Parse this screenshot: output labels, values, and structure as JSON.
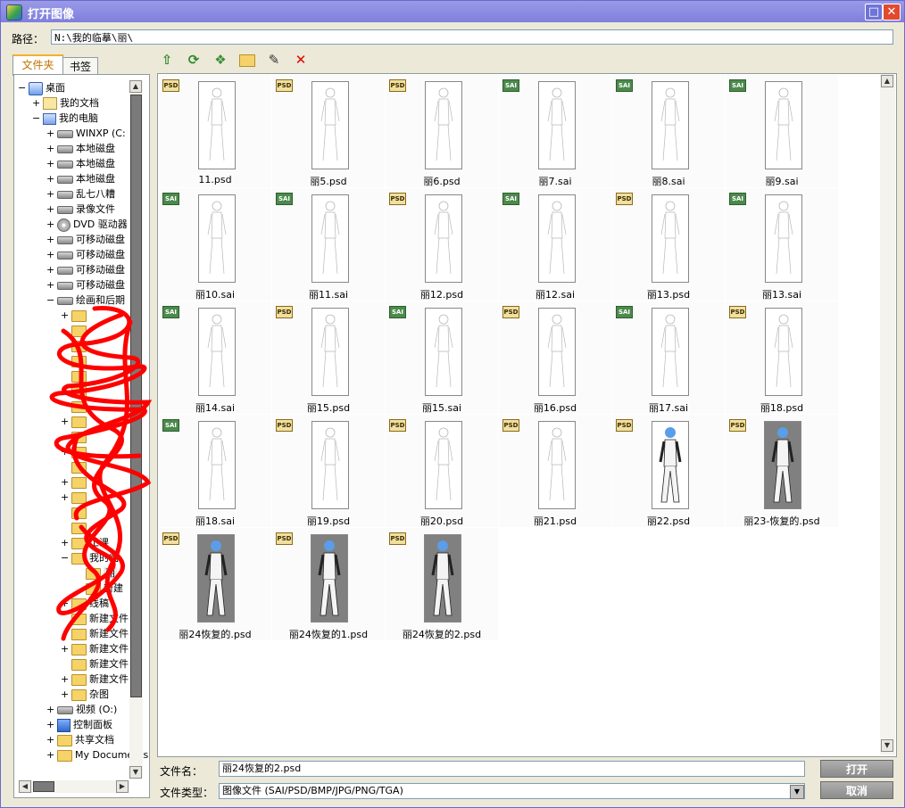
{
  "window": {
    "title": "打开图像"
  },
  "path": {
    "label": "路径：",
    "value": "N:\\我的临摹\\丽\\"
  },
  "tabs": {
    "folders": "文件夹",
    "bookmarks": "书签"
  },
  "tree": [
    {
      "label": "桌面",
      "exp": "−",
      "icon": "desktop-icon"
    },
    {
      "label": "我的文档",
      "exp": "+",
      "icon": "documents-icon"
    },
    {
      "label": "我的电脑",
      "exp": "−",
      "icon": "computer-icon"
    },
    {
      "label": "WINXP (C:",
      "exp": "+",
      "icon": "drive-icon"
    },
    {
      "label": "本地磁盘",
      "exp": "+",
      "icon": "drive-icon"
    },
    {
      "label": "本地磁盘",
      "exp": "+",
      "icon": "drive-icon"
    },
    {
      "label": "本地磁盘",
      "exp": "+",
      "icon": "drive-icon"
    },
    {
      "label": "乱七八糟",
      "exp": "+",
      "icon": "drive-icon"
    },
    {
      "label": "录像文件",
      "exp": "+",
      "icon": "drive-icon"
    },
    {
      "label": "DVD 驱动器",
      "exp": "+",
      "icon": "dvd-icon"
    },
    {
      "label": "可移动磁盘",
      "exp": "+",
      "icon": "drive-icon"
    },
    {
      "label": "可移动磁盘",
      "exp": "+",
      "icon": "drive-icon"
    },
    {
      "label": "可移动磁盘",
      "exp": "+",
      "icon": "drive-icon"
    },
    {
      "label": "可移动磁盘",
      "exp": "+",
      "icon": "drive-icon"
    },
    {
      "label": "绘画和后期",
      "exp": "−",
      "icon": "drive-icon"
    },
    {
      "label": "",
      "exp": "+",
      "icon": "folder-icon"
    },
    {
      "label": "",
      "exp": "",
      "icon": "folder-icon"
    },
    {
      "label": "",
      "exp": "",
      "icon": "folder-icon"
    },
    {
      "label": "",
      "exp": "",
      "icon": "folder-icon"
    },
    {
      "label": "",
      "exp": "",
      "icon": "folder-icon"
    },
    {
      "label": "",
      "exp": "+",
      "icon": "folder-icon"
    },
    {
      "label": "",
      "exp": "",
      "icon": "folder-icon"
    },
    {
      "label": "",
      "exp": "+",
      "icon": "folder-icon"
    },
    {
      "label": "",
      "exp": "",
      "icon": "folder-icon"
    },
    {
      "label": "",
      "exp": "+",
      "icon": "folder-icon"
    },
    {
      "label": "",
      "exp": "",
      "icon": "folder-icon"
    },
    {
      "label": "",
      "exp": "+",
      "icon": "folder-icon"
    },
    {
      "label": "",
      "exp": "+",
      "icon": "folder-icon"
    },
    {
      "label": "",
      "exp": "",
      "icon": "folder-icon"
    },
    {
      "label": "",
      "exp": "",
      "icon": "folder-icon"
    },
    {
      "label": "工课",
      "exp": "+",
      "icon": "folder-icon"
    },
    {
      "label": "我的临",
      "exp": "−",
      "icon": "folder-icon"
    },
    {
      "label": "丽",
      "exp": "",
      "icon": "folder-icon",
      "selected": true
    },
    {
      "label": "新建",
      "exp": "",
      "icon": "folder-icon"
    },
    {
      "label": "线稿",
      "exp": "+",
      "icon": "folder-icon"
    },
    {
      "label": "新建文件",
      "exp": "",
      "icon": "folder-icon"
    },
    {
      "label": "新建文件",
      "exp": "",
      "icon": "folder-icon"
    },
    {
      "label": "新建文件",
      "exp": "+",
      "icon": "folder-icon"
    },
    {
      "label": "新建文件",
      "exp": "",
      "icon": "folder-icon"
    },
    {
      "label": "新建文件",
      "exp": "+",
      "icon": "folder-icon"
    },
    {
      "label": "杂图",
      "exp": "+",
      "icon": "folder-icon"
    },
    {
      "label": "视频 (O:)",
      "exp": "+",
      "icon": "drive-icon"
    },
    {
      "label": "控制面板",
      "exp": "+",
      "icon": "control-panel-icon"
    },
    {
      "label": "共享文档",
      "exp": "+",
      "icon": "folder-icon"
    },
    {
      "label": "My Documents",
      "exp": "+",
      "icon": "folder-icon"
    }
  ],
  "toolbar_icons": [
    "up-folder-icon",
    "refresh-icon",
    "bookmark-icon",
    "new-folder-icon",
    "rename-icon",
    "delete-icon"
  ],
  "files": [
    {
      "name": "11.psd",
      "type": "PSD",
      "colored": false
    },
    {
      "name": "丽5.psd",
      "type": "PSD",
      "colored": false
    },
    {
      "name": "丽6.psd",
      "type": "PSD",
      "colored": false
    },
    {
      "name": "丽7.sai",
      "type": "SAI",
      "colored": false
    },
    {
      "name": "丽8.sai",
      "type": "SAI",
      "colored": false
    },
    {
      "name": "丽9.sai",
      "type": "SAI",
      "colored": false
    },
    {
      "name": "丽10.sai",
      "type": "SAI",
      "colored": false
    },
    {
      "name": "丽11.sai",
      "type": "SAI",
      "colored": false
    },
    {
      "name": "丽12.psd",
      "type": "PSD",
      "colored": false
    },
    {
      "name": "丽12.sai",
      "type": "SAI",
      "colored": false
    },
    {
      "name": "丽13.psd",
      "type": "PSD",
      "colored": false
    },
    {
      "name": "丽13.sai",
      "type": "SAI",
      "colored": false
    },
    {
      "name": "丽14.sai",
      "type": "SAI",
      "colored": false
    },
    {
      "name": "丽15.psd",
      "type": "PSD",
      "colored": false
    },
    {
      "name": "丽15.sai",
      "type": "SAI",
      "colored": false
    },
    {
      "name": "丽16.psd",
      "type": "PSD",
      "colored": false
    },
    {
      "name": "丽17.sai",
      "type": "SAI",
      "colored": false
    },
    {
      "name": "丽18.psd",
      "type": "PSD",
      "colored": false
    },
    {
      "name": "丽18.sai",
      "type": "SAI",
      "colored": false
    },
    {
      "name": "丽19.psd",
      "type": "PSD",
      "colored": false
    },
    {
      "name": "丽20.psd",
      "type": "PSD",
      "colored": false
    },
    {
      "name": "丽21.psd",
      "type": "PSD",
      "colored": false
    },
    {
      "name": "丽22.psd",
      "type": "PSD",
      "colored": true,
      "bg": "white"
    },
    {
      "name": "丽23-恢复的.psd",
      "type": "PSD",
      "colored": true,
      "bg": "gray"
    },
    {
      "name": "丽24恢复的.psd",
      "type": "PSD",
      "colored": true,
      "bg": "gray"
    },
    {
      "name": "丽24恢复的1.psd",
      "type": "PSD",
      "colored": true,
      "bg": "gray"
    },
    {
      "name": "丽24恢复的2.psd",
      "type": "PSD",
      "colored": true,
      "bg": "gray"
    }
  ],
  "footer": {
    "filename_label": "文件名：",
    "filename_value": "丽24恢复的2.psd",
    "filetype_label": "文件类型：",
    "filetype_value": "图像文件 (SAI/PSD/BMP/JPG/PNG/TGA)",
    "open_button": "打开",
    "cancel_button": "取消"
  }
}
